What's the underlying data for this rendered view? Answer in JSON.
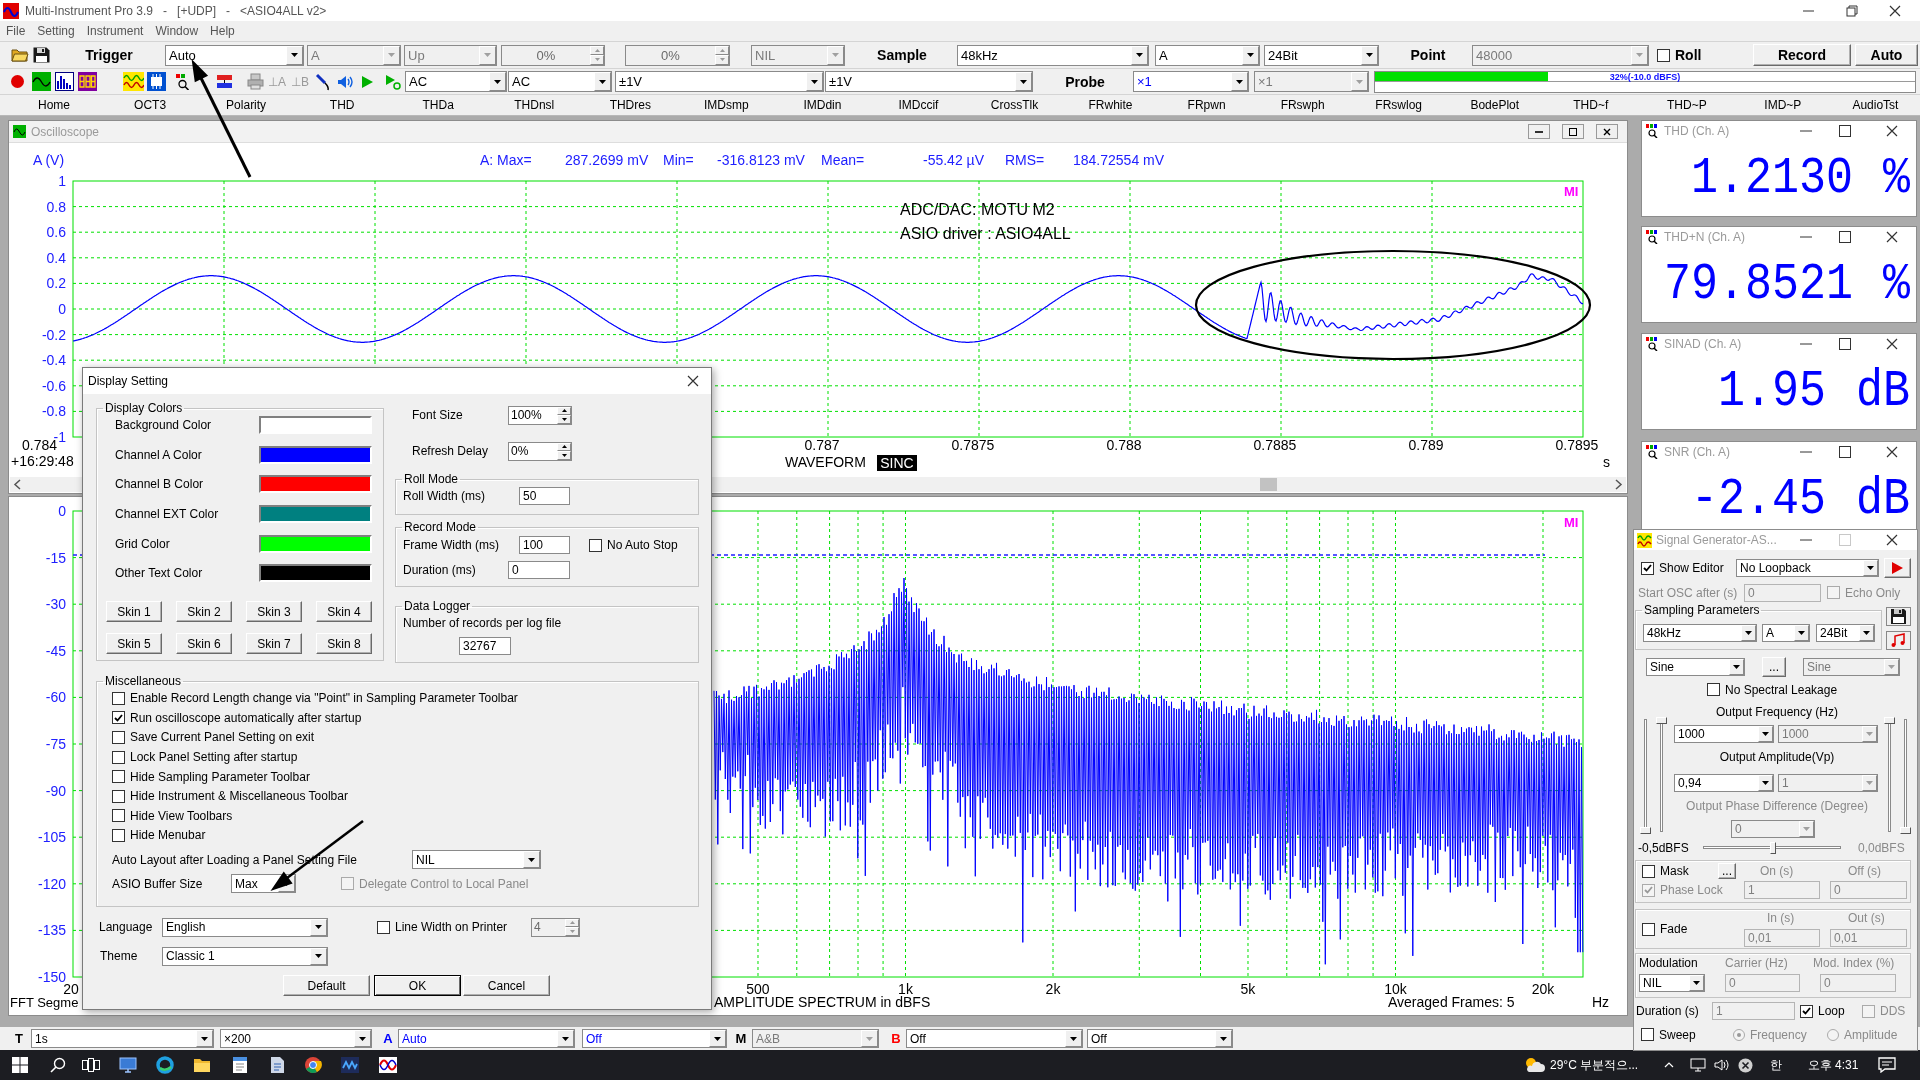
{
  "window": {
    "title": "Multi-Instrument Pro 3.9   -   [+UDP]   -   <ASIO4ALL v2>"
  },
  "menu": [
    "File",
    "Setting",
    "Instrument",
    "Window",
    "Help"
  ],
  "toolbar_top": [
    {
      "kind": "label",
      "text": "Trigger"
    },
    {
      "kind": "dropdown",
      "text": "Auto",
      "disabled": false
    },
    {
      "kind": "dropdown",
      "text": "A",
      "disabled": true
    },
    {
      "kind": "dropdown",
      "text": "Up",
      "disabled": true
    },
    {
      "kind": "spin",
      "text": "0%",
      "disabled": true
    },
    {
      "kind": "spin",
      "text": "0%",
      "disabled": true
    },
    {
      "kind": "dropdown",
      "text": "NIL",
      "disabled": true
    },
    {
      "kind": "label",
      "text": "Sample"
    },
    {
      "kind": "dropdown",
      "text": "48kHz",
      "disabled": false
    },
    {
      "kind": "dropdown",
      "text": "A",
      "disabled": false
    },
    {
      "kind": "dropdown",
      "text": "24Bit",
      "disabled": false
    },
    {
      "kind": "label",
      "text": "Point"
    },
    {
      "kind": "dropdown",
      "text": "48000",
      "disabled": true
    },
    {
      "kind": "checkbox",
      "text": "Roll",
      "checked": false
    },
    {
      "kind": "button",
      "text": "Record"
    },
    {
      "kind": "button",
      "text": "Auto"
    }
  ],
  "toolbar_middle": {
    "tools": [
      {
        "text": "⊥A",
        "disabled": true
      },
      {
        "text": "⊥B",
        "disabled": true
      }
    ],
    "controls": [
      {
        "kind": "dropdown",
        "text": "AC",
        "disabled": false
      },
      {
        "kind": "dropdown",
        "text": "AC",
        "disabled": false
      },
      {
        "kind": "dropdown",
        "text": "±1V",
        "disabled": false
      },
      {
        "kind": "dropdown",
        "text": "±1V",
        "disabled": false
      },
      {
        "kind": "label",
        "text": "Probe"
      },
      {
        "kind": "dropdown",
        "text": "×1",
        "disabled": false,
        "color": "#0000ff"
      },
      {
        "kind": "dropdown",
        "text": "×1",
        "disabled": true
      }
    ],
    "input_level": {
      "level": 0.32,
      "reading": "32%(-10.0 dBFS)"
    }
  },
  "views": [
    "Home",
    "OCT3",
    "Polarity",
    "THD",
    "THDa",
    "THDnsl",
    "THDres",
    "IMDsmp",
    "IMDdin",
    "IMDccif",
    "CrossTlk",
    "FRwhite",
    "FRpwn",
    "FRswph",
    "FRswlog",
    "BodePlot",
    "THD~f",
    "THD~P",
    "IMD~P",
    "AudioTst"
  ],
  "oscilloscope": {
    "title": "Oscilloscope",
    "y_title": "A (V)",
    "stats": [
      {
        "label": "A: Max=",
        "value": "287.2699 mV"
      },
      {
        "label": "Min=",
        "value": "-316.8123 mV"
      },
      {
        "label": "Mean=",
        "value": "-55.42 µV"
      },
      {
        "label": "RMS=",
        "value": "184.72554 mV"
      }
    ],
    "y_labels": [
      "1",
      "0.8",
      "0.6",
      "0.4",
      "0.2",
      "0",
      "-0.2",
      "-0.4",
      "-0.6",
      "-0.8",
      "-1"
    ],
    "x_start_label": "0.784",
    "time_label": "+16:29:48",
    "x_labels": [
      "0.787",
      "0.7875",
      "0.788",
      "0.7885",
      "0.789",
      "0.7895"
    ],
    "x_unit": "s",
    "mode": "WAVEFORM",
    "filter": "SINC",
    "logo": "MI",
    "notes": [
      "ADC/DAC: MOTU M2",
      "ASIO driver : ASIO4ALL"
    ]
  },
  "spectrum": {
    "y_labels": [
      "0",
      "-15",
      "-30",
      "-45",
      "-60",
      "-75",
      "-90",
      "-105",
      "-120",
      "-135",
      "-150"
    ],
    "x_labels": [
      "20",
      "500",
      "1k",
      "2k",
      "5k",
      "10k",
      "20k"
    ],
    "x_unit": "Hz",
    "segments": "FFT Segme",
    "title": "AMPLITUDE SPECTRUM in dBFS",
    "frames": "Averaged Frames: 5",
    "logo": "MI"
  },
  "meters": [
    {
      "title": "THD (Ch. A)",
      "value": "1.2130",
      "unit": "%"
    },
    {
      "title": "THD+N (Ch. A)",
      "value": "79.8521",
      "unit": "%"
    },
    {
      "title": "SINAD (Ch. A)",
      "value": "1.95",
      "unit": "dB"
    },
    {
      "title": "SNR (Ch. A)",
      "value": "-2.45",
      "unit": "dB"
    }
  ],
  "signal_generator": {
    "title": "Signal Generator-AS...",
    "show_editor": {
      "label": "Show Editor",
      "checked": true
    },
    "loopback": "No Loopback",
    "start_osc": {
      "label": "Start OSC after (s)",
      "value": "0",
      "disabled": true
    },
    "echo_only": {
      "label": "Echo Only",
      "checked": false,
      "disabled": true
    },
    "sampling": {
      "title": "Sampling Parameters",
      "rate": "48kHz",
      "channel": "A",
      "bits": "24Bit"
    },
    "waveforms": [
      {
        "text": "Sine",
        "disabled": false
      },
      {
        "text": "Sine",
        "disabled": true
      }
    ],
    "more_button": "...",
    "no_spectral_leakage": {
      "label": "No Spectral Leakage",
      "checked": false
    },
    "frequency": {
      "label": "Output Frequency (Hz)",
      "values": [
        {
          "text": "1000",
          "disabled": false
        },
        {
          "text": "1000",
          "disabled": true
        }
      ]
    },
    "amplitude": {
      "label": "Output Amplitude(Vp)",
      "values": [
        {
          "text": "0,94",
          "disabled": false
        },
        {
          "text": "1",
          "disabled": true
        }
      ]
    },
    "phase": {
      "label": "Output Phase Difference (Degree)",
      "value": "0",
      "disabled": true
    },
    "sliders_left": [
      {
        "level": 0
      },
      {
        "level": 1
      }
    ],
    "sliders_right": [
      {
        "level": 1
      },
      {
        "level": 0
      }
    ],
    "balance": {
      "min_label": "-0,5dBFS",
      "max_label": "0,0dBFS",
      "max_disabled": true,
      "level": 0.51
    },
    "mask": {
      "label": "Mask",
      "checked": false,
      "button": "...",
      "on_label": "On (s)",
      "off_label": "Off (s)",
      "phase_lock": {
        "label": "Phase Lock",
        "checked": true
      },
      "on_value": "1",
      "off_value": "0"
    },
    "fade": {
      "label": "Fade",
      "checked": false,
      "in_label": "In (s)",
      "out_label": "Out (s)",
      "in_value": "0,01",
      "out_value": "0,01"
    },
    "modulation": {
      "label": "Modulation",
      "value": "NIL",
      "carrier_label": "Carrier (Hz)",
      "carrier_value": "0",
      "index_label": "Mod. Index (%)",
      "index_value": "0",
      "params_disabled": true
    },
    "duration": {
      "label": "Duration (s)",
      "value": "1",
      "disabled": true
    },
    "loop": {
      "label": "Loop",
      "checked": true
    },
    "dds": {
      "label": "DDS",
      "checked": false,
      "disabled": true
    },
    "sweep": {
      "label": "Sweep",
      "checked": false
    },
    "sweep_modes": [
      {
        "label": "Frequency",
        "selected": true
      },
      {
        "label": "Amplitude",
        "selected": false
      }
    ]
  },
  "dialog": {
    "title": "Display Setting",
    "colors": {
      "title": "Display Colors",
      "items": [
        {
          "label": "Background Color",
          "color": "#ffffff"
        },
        {
          "label": "Channel A Color",
          "color": "#0000ff"
        },
        {
          "label": "Channel B Color",
          "color": "#ff0000"
        },
        {
          "label": "Channel EXT Color",
          "color": "#008080"
        },
        {
          "label": "Grid Color",
          "color": "#00ff00"
        },
        {
          "label": "Other Text Color",
          "color": "#000000"
        }
      ],
      "skins": [
        "Skin 1",
        "Skin 2",
        "Skin 3",
        "Skin 4",
        "Skin 5",
        "Skin 6",
        "Skin 7",
        "Skin 8"
      ]
    },
    "font_size": {
      "label": "Font Size",
      "value": "100%"
    },
    "refresh_delay": {
      "label": "Refresh Delay",
      "value": "0%"
    },
    "roll_mode": {
      "title": "Roll Mode",
      "label": "Roll Width (ms)",
      "value": "50"
    },
    "record_mode": {
      "title": "Record Mode",
      "frame_label": "Frame Width (ms)",
      "frame_value": "100",
      "no_auto_stop": {
        "label": "No Auto Stop",
        "checked": false
      },
      "duration_label": "Duration (ms)",
      "duration_value": "0"
    },
    "data_logger": {
      "title": "Data Logger",
      "label": "Number of records per log file",
      "value": "32767"
    },
    "misc": {
      "title": "Miscellaneous",
      "options": [
        {
          "label": "Enable Record Length change via \"Point\" in Sampling Parameter Toolbar",
          "checked": false
        },
        {
          "label": "Run oscilloscope automatically after startup",
          "checked": true
        },
        {
          "label": "Save Current Panel Setting on exit",
          "checked": false
        },
        {
          "label": "Lock Panel Setting after startup",
          "checked": false
        },
        {
          "label": "Hide Sampling Parameter Toolbar",
          "checked": false
        },
        {
          "label": "Hide Instrument & Miscellaneous Toolbar",
          "checked": false
        },
        {
          "label": "Hide View Toolbars",
          "checked": false
        },
        {
          "label": "Hide Menubar",
          "checked": false
        }
      ],
      "auto_layout": {
        "label": "Auto Layout after Loading a Panel Setting File",
        "value": "NIL"
      },
      "asio_buffer": {
        "label": "ASIO Buffer Size",
        "value": "Max"
      },
      "delegate": {
        "label": "Delegate Control to Local Panel",
        "checked": false,
        "disabled": true
      }
    },
    "language": {
      "label": "Language",
      "value": "English"
    },
    "line_width": {
      "label": "Line Width on Printer",
      "checked": false,
      "value": "4"
    },
    "theme": {
      "label": "Theme",
      "value": "Classic 1"
    },
    "buttons": [
      {
        "label": "Default",
        "focused": false
      },
      {
        "label": "OK",
        "focused": true
      },
      {
        "label": "Cancel",
        "focused": false
      }
    ]
  },
  "status_bar": [
    {
      "kind": "label",
      "text": "T"
    },
    {
      "kind": "dropdown",
      "text": "1s",
      "disabled": false
    },
    {
      "kind": "dropdown",
      "text": "×200",
      "disabled": false
    },
    {
      "kind": "label",
      "text": "A",
      "color": "#0000ff"
    },
    {
      "kind": "dropdown",
      "text": "Auto",
      "disabled": false,
      "color": "#0000ff"
    },
    {
      "kind": "dropdown",
      "text": "Off",
      "disabled": false,
      "color": "#0000ff"
    },
    {
      "kind": "label",
      "text": "M"
    },
    {
      "kind": "dropdown",
      "text": "A&B",
      "disabled": true
    },
    {
      "kind": "label",
      "text": "B",
      "color": "#ff0000"
    },
    {
      "kind": "dropdown",
      "text": "Off",
      "disabled": false
    },
    {
      "kind": "dropdown",
      "text": "Off",
      "disabled": false
    }
  ],
  "taskbar": {
    "weather": "29°C 부분적으...",
    "ime": "한",
    "time": "오후 4:31"
  }
}
